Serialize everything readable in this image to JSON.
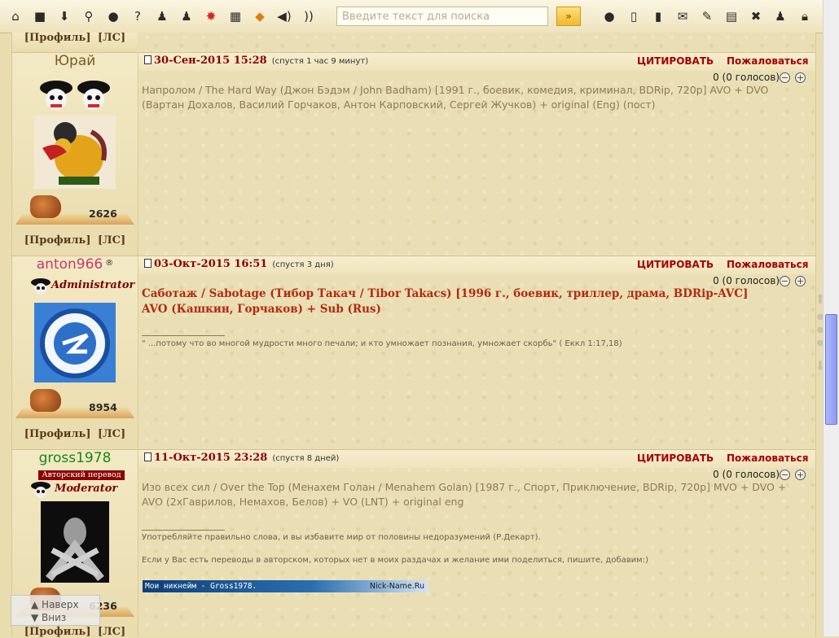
{
  "toolbar": {
    "icons": [
      "home-icon",
      "chat-icon",
      "download-icon",
      "search-icon",
      "record-icon",
      "help-icon",
      "users-icon",
      "user-group-icon",
      "star-icon",
      "calculator-icon",
      "tag-icon",
      "sound-icon",
      "rss-icon"
    ],
    "search_placeholder": "Введите текст для поиска",
    "search_button": "»",
    "right_icons": [
      "info-icon",
      "copy-icon",
      "bookmark-icon",
      "mail-icon",
      "edit-icon",
      "document-icon",
      "close-icon",
      "person-icon",
      "lock-icon"
    ]
  },
  "profile_links": {
    "profile": "[Профиль]",
    "pm": "[ЛС]"
  },
  "posts": [
    {
      "author": "Юрай",
      "author_color": "#7a5a2a",
      "rank_text": "",
      "date": "30-Сен-2015 15:28",
      "ago": "(спустя 1 час 9 минут)",
      "quote": "ЦИТИРОВАТЬ",
      "report": "Пожаловаться",
      "votes": "0 (0 голосов)",
      "reputation": "2626",
      "body": "Напролом / The Hard Way (Джон Бэдэм / John Badham) [1991 г., боевик, комедия, криминал, BDRip, 720p] AVO + DVO (Вартан Дохалов, Василий Горчаков, Антон Карповский, Сергей Жучков) + original (Eng) (пост)"
    },
    {
      "author": "anton966",
      "author_suffix": "®",
      "author_color": "#c43b6b",
      "rank_text": "Administrator",
      "date": "03-Окт-2015 16:51",
      "ago": "(спустя 3 дня)",
      "quote": "ЦИТИРОВАТЬ",
      "report": "Пожаловаться",
      "votes": "0 (0 голосов)",
      "reputation": "8954",
      "body": "Саботаж / Sabotage (Тибор Такач / Tibor Takacs) [1996 г., боевик, триллер, драма, BDRip-AVC] AVO (Кашкин, Горчаков) + Sub (Rus)",
      "signature": "\" ...потому что во многой мудрости много печали; и кто умножает познания, умножает скорбь\" ( Еккл 1:17,18)"
    },
    {
      "author": "gross1978",
      "author_color": "#138a13",
      "rank_tag": "Авторский перевод",
      "rank_text": "Moderator",
      "date": "11-Окт-2015 23:28",
      "ago": "(спустя 8 дней)",
      "quote": "ЦИТИРОВАТЬ",
      "report": "Пожаловаться",
      "votes": "0 (0 голосов)",
      "reputation": "6236",
      "body": "Изо всех сил / Over the Top (Менахем Голан / Menahem Golan) [1987 г., Спорт, Приключение, BDRip, 720p] MVO + DVO + AVO (2хГаврилов, Немахов, Белов) + VO (LNT) + original eng",
      "signature_1": "Употребляйте правильно слова, и вы избавите мир от половины недоразумений (Р.Декарт).",
      "signature_2": "Если у Вас есть переводы в авторском, которых нет в моих раздачах и желание ими поделиться, пишите, добавим:)",
      "banner_text": "Мои никнейм - Gross1978.",
      "banner_site": "Nick-Name.Ru"
    }
  ],
  "floating_nav": {
    "up": "▲ Наверх",
    "down": "▼ Вниз"
  }
}
